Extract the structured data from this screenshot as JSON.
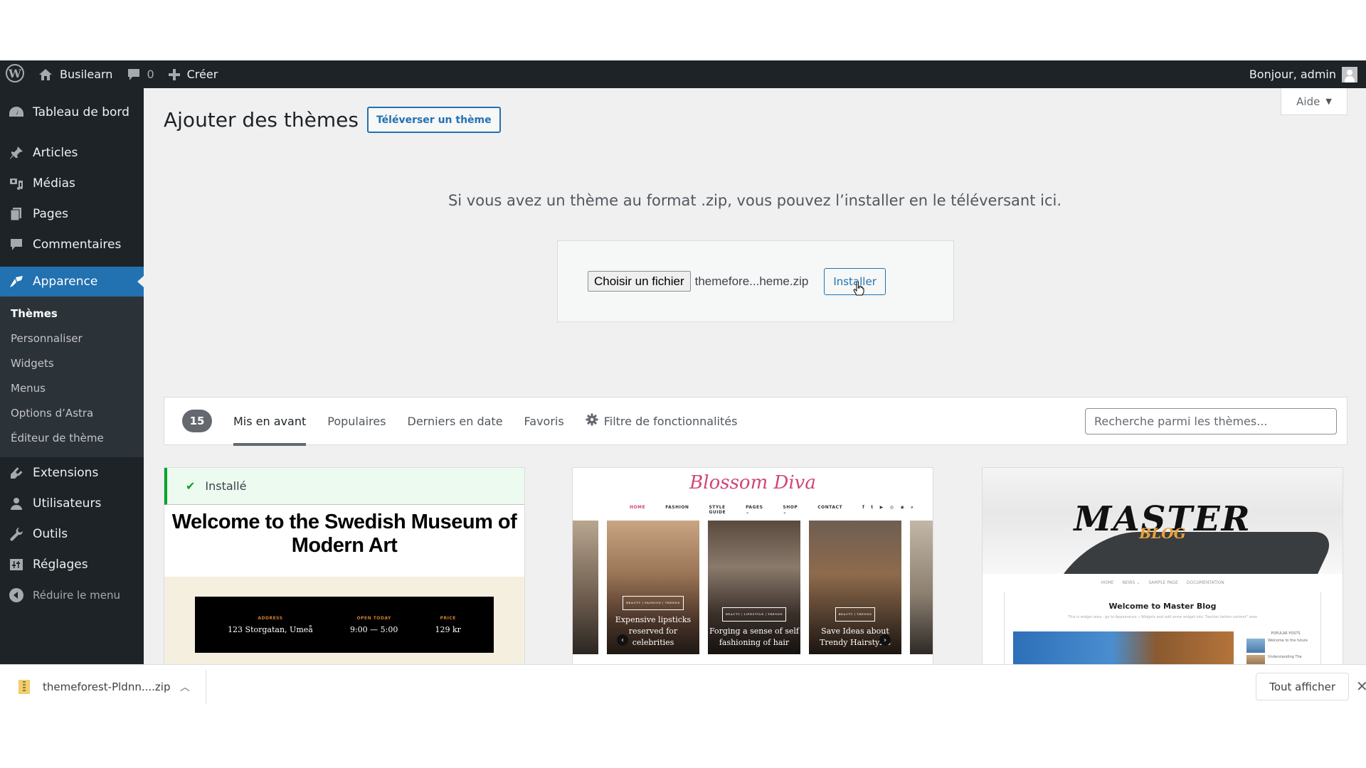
{
  "admin_bar": {
    "site_name": "Busilearn",
    "comments_count": "0",
    "new_label": "Créer",
    "greeting": "Bonjour, admin"
  },
  "help_tab": {
    "label": "Aide"
  },
  "sidebar": {
    "items": [
      {
        "label": "Tableau de bord",
        "icon": "dashboard-icon"
      },
      {
        "label": "Articles",
        "icon": "pin-icon"
      },
      {
        "label": "Médias",
        "icon": "media-icon"
      },
      {
        "label": "Pages",
        "icon": "pages-icon"
      },
      {
        "label": "Commentaires",
        "icon": "comment-icon"
      },
      {
        "label": "Apparence",
        "icon": "paintbrush-icon",
        "active": true
      },
      {
        "label": "Extensions",
        "icon": "plugin-icon"
      },
      {
        "label": "Utilisateurs",
        "icon": "user-icon"
      },
      {
        "label": "Outils",
        "icon": "wrench-icon"
      },
      {
        "label": "Réglages",
        "icon": "settings-icon"
      }
    ],
    "submenu": [
      {
        "label": "Thèmes",
        "current": true
      },
      {
        "label": "Personnaliser"
      },
      {
        "label": "Widgets"
      },
      {
        "label": "Menus"
      },
      {
        "label": "Options d’Astra"
      },
      {
        "label": "Éditeur de thème"
      }
    ],
    "collapse_label": "Réduire le menu"
  },
  "page": {
    "title": "Ajouter des thèmes",
    "upload_button": "Téléverser un thème",
    "upload_description": "Si vous avez un thème au format .zip, vous pouvez l’installer en le téléversant ici.",
    "file_button": "Choisir un fichier",
    "file_name": "themefore...heme.zip",
    "install_button": "Installer"
  },
  "filter_bar": {
    "count": "15",
    "tabs": [
      {
        "label": "Mis en avant",
        "current": true
      },
      {
        "label": "Populaires"
      },
      {
        "label": "Derniers en date"
      },
      {
        "label": "Favoris"
      }
    ],
    "feature_filter": "Filtre de fonctionnalités",
    "search_placeholder": "Recherche parmi les thèmes..."
  },
  "themes": [
    {
      "installed_label": "Installé",
      "preview": {
        "headline": "Welcome to the Swedish Museum of Modern Art",
        "info": [
          {
            "label": "ADDRESS",
            "value": "123 Storgatan, Umeå"
          },
          {
            "label": "OPEN TODAY",
            "value": "9:00 — 5:00"
          },
          {
            "label": "PRICE",
            "value": "129 kr"
          }
        ]
      }
    },
    {
      "preview": {
        "logo": "Blossom Diva",
        "nav": [
          "HOME",
          "FASHION",
          "STYLE GUIDE",
          "PAGES ⌄",
          "SHOP ⌄",
          "CONTACT"
        ],
        "social": [
          "f",
          "t",
          "▶",
          "◎",
          "◉",
          "⌕"
        ],
        "slides": [
          {
            "tags": "BEAUTY | FASHION | TRENDS",
            "title": "Expensive lipsticks reserved for celebrities"
          },
          {
            "tags": "BEAUTY | LIFESTYLE | TRENDS",
            "title": "Forging a sense of self fashioning of hair"
          },
          {
            "tags": "BEAUTY | TRENDS",
            "title": "Save Ideas about Trendy Hairstyles"
          }
        ]
      }
    },
    {
      "preview": {
        "logo": "MASTER",
        "logo_sub": "BLOG",
        "nav": [
          "HOME",
          "NEWS ⌄",
          "SAMPLE PAGE",
          "DOCUMENTATION"
        ],
        "welcome": "Welcome to Master Blog",
        "description": "This is widget area - go to Appearance » Widgets and add some widget into \"Section before content\" area",
        "popular_label": "POPULAR POSTS",
        "popular_posts": [
          "Welcome to the future",
          "Understanding The"
        ]
      }
    }
  ],
  "downloads": {
    "file_name": "themeforest-Pldnn....zip",
    "show_all": "Tout afficher"
  }
}
